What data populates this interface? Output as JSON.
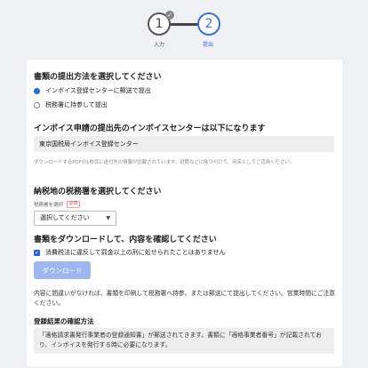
{
  "stepper": {
    "step1_number": "1",
    "step1_label": "入力",
    "step2_number": "2",
    "step2_label": "提出"
  },
  "submission_method": {
    "title": "書類の提出方法を選択してください",
    "options": [
      "インボイス登録センターに郵送で提出",
      "税務署に持参して提出"
    ],
    "selected_index": 0
  },
  "invoice_center": {
    "title": "インボイス申請の提出先のインボイスセンターは以下になります",
    "value": "東京国税局インボイス登録センター",
    "note": "ダウンロードするPDFの1枚目に送付先の情報が記載されています。封筒などに貼り付けて、宛名としてご活用ください。"
  },
  "tax_office": {
    "title": "納税地の税務署を選択してください",
    "field_label": "税務署を選択",
    "required_badge": "必須",
    "select_value": "選択してください"
  },
  "download": {
    "title": "書類をダウンロードして、内容を確認してください",
    "checkbox_label": "消費税法に違反して罰金以上の刑に処せられたことはありません",
    "button_label": "ダウンロード"
  },
  "instructions": {
    "text": "内容に間違いがなければ、書類を印刷して税務署へ持参、または郵送にて提出してください。営業時間にご注意ください。"
  },
  "result": {
    "title": "登録結果の確認方法",
    "text": "「適格請求書発行事業者の登録通知書」が郵送されてきます。書類に「適格事業者番号」が記載されており、インボイスを発行する時に必要になります。"
  },
  "colors": {
    "accent": "#2a63d6",
    "button_disabled": "#9db8ee",
    "background": "#eef0f4"
  }
}
